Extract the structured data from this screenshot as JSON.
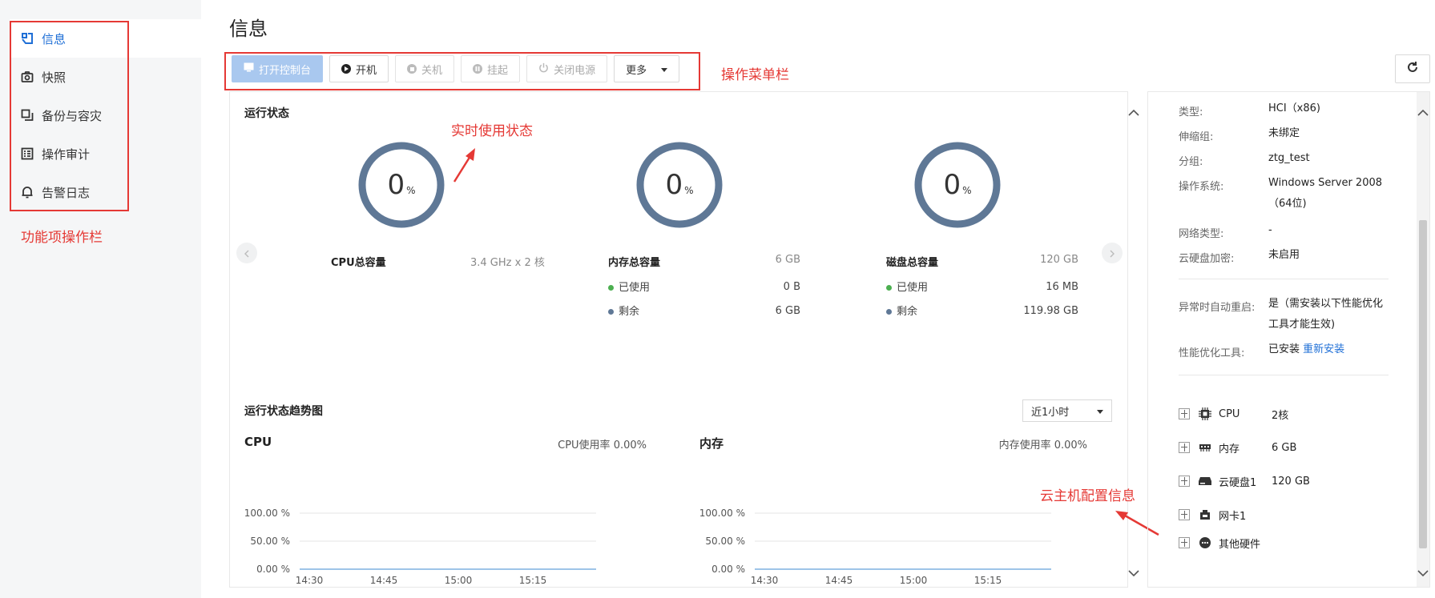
{
  "sidebar": {
    "items": [
      {
        "label": "信息",
        "icon": "info-icon",
        "active": true
      },
      {
        "label": "快照",
        "icon": "camera-icon"
      },
      {
        "label": "备份与容灾",
        "icon": "backup-icon"
      },
      {
        "label": "操作审计",
        "icon": "audit-icon"
      },
      {
        "label": "告警日志",
        "icon": "bell-icon"
      }
    ],
    "annotation": "功能项操作栏"
  },
  "page": {
    "title": "信息"
  },
  "toolbar": {
    "open_console": "打开控制台",
    "power_on": "开机",
    "shutdown": "关机",
    "suspend": "挂起",
    "power_off": "关闭电源",
    "more": "更多",
    "annotation": "操作菜单栏"
  },
  "status": {
    "title": "运行状态",
    "annotation": "实时使用状态",
    "gauges": [
      {
        "value": "0",
        "unit": "%"
      },
      {
        "value": "0",
        "unit": "%"
      },
      {
        "value": "0",
        "unit": "%"
      }
    ],
    "cpu": {
      "label": "CPU总容量",
      "value": "3.4 GHz x 2 核"
    },
    "memory": {
      "label": "内存总容量",
      "value": "6 GB",
      "used_label": "已使用",
      "used": "0 B",
      "free_label": "剩余",
      "free": "6 GB"
    },
    "disk": {
      "label": "磁盘总容量",
      "value": "120 GB",
      "used_label": "已使用",
      "used": "16 MB",
      "free_label": "剩余",
      "free": "119.98 GB"
    }
  },
  "trend": {
    "title": "运行状态趋势图",
    "range": "近1小时",
    "cpu_title": "CPU",
    "cpu_usage": "CPU使用率 0.00%",
    "mem_title": "内存",
    "mem_usage": "内存使用率 0.00%",
    "cpu_caption": "CPU使用率",
    "mem_caption": "内存使用率"
  },
  "chart_data": [
    {
      "type": "line",
      "title": "CPU",
      "x": [
        "14:30",
        "14:45",
        "15:00",
        "15:15"
      ],
      "y_ticks": [
        "100.00 %",
        "50.00 %",
        "0.00 %"
      ],
      "ylim": [
        0,
        100
      ],
      "series": [
        {
          "values": [
            0,
            0,
            0,
            0
          ]
        }
      ],
      "xlabel": "CPU使用率"
    },
    {
      "type": "line",
      "title": "内存",
      "x": [
        "14:30",
        "14:45",
        "15:00",
        "15:15"
      ],
      "y_ticks": [
        "100.00 %",
        "50.00 %",
        "0.00 %"
      ],
      "ylim": [
        0,
        100
      ],
      "series": [
        {
          "values": [
            0,
            0,
            0,
            0
          ]
        }
      ],
      "xlabel": "内存使用率"
    }
  ],
  "details": {
    "type_key": "类型:",
    "type_val": "HCI（x86)",
    "scaling_key": "伸缩组:",
    "scaling_val": "未绑定",
    "group_key": "分组:",
    "group_val": "ztg_test",
    "os_key": "操作系统:",
    "os_val_1": "Windows Server 2008",
    "os_val_2": "（64位)",
    "net_key": "网络类型:",
    "net_val": "-",
    "enc_key": "云硬盘加密:",
    "enc_val": "未启用",
    "restart_key": "异常时自动重启:",
    "restart_val_1": "是（需安装以下性能优化",
    "restart_val_2": "工具才能生效)",
    "tool_key": "性能优化工具:",
    "tool_val": "已安装",
    "tool_link": "重新安装"
  },
  "hardware": {
    "annotation": "云主机配置信息",
    "items": [
      {
        "name": "CPU",
        "value": "2核"
      },
      {
        "name": "内存",
        "value": "6 GB"
      },
      {
        "name": "云硬盘1",
        "value": "120 GB"
      },
      {
        "name": "网卡1",
        "value": ""
      },
      {
        "name": "其他硬件",
        "value": ""
      }
    ]
  },
  "colors": {
    "accent": "#1f6fd6",
    "annotation": "#e53935",
    "gauge": "#5f7896",
    "used": "#4caf50",
    "free": "#5f7896"
  }
}
